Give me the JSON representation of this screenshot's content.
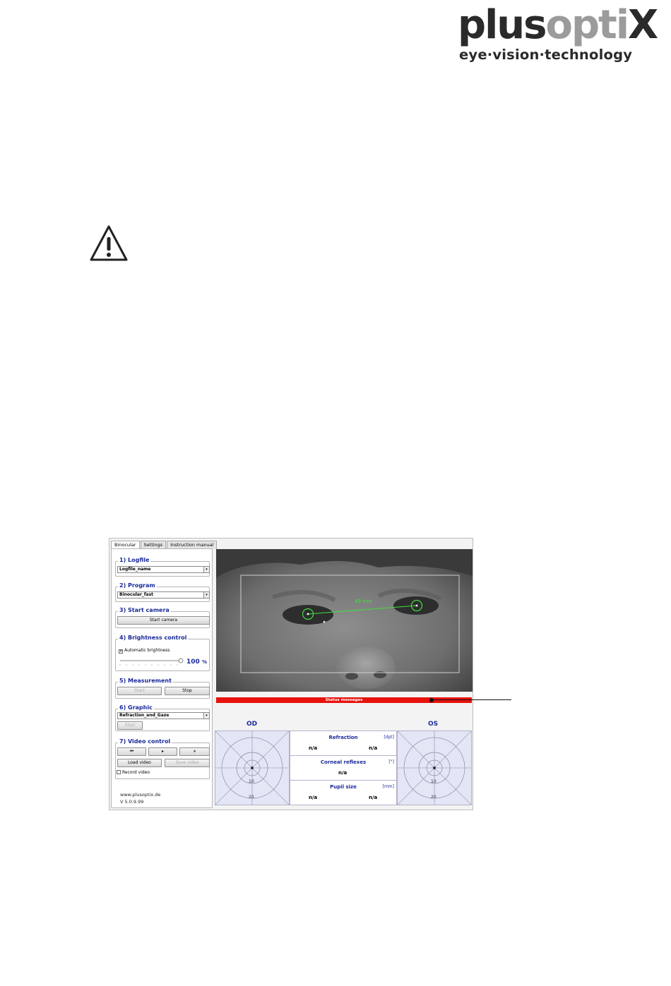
{
  "logo": {
    "word_plus": "plus",
    "word_optix": "opti",
    "word_x": "X",
    "tagline": "eye·vision·technology"
  },
  "warning": {
    "icon": "warning-triangle-icon"
  },
  "app": {
    "tabs": [
      "Binocular",
      "Settings",
      "Instruction manual"
    ],
    "logfile": {
      "title": "1) Logfile",
      "value": "Logfile_name"
    },
    "program": {
      "title": "2) Program",
      "value": "Binocular_fast"
    },
    "start_camera": {
      "title": "3) Start camera",
      "button": "Start camera"
    },
    "brightness": {
      "title": "4) Brightness control",
      "auto_label": "Automatic brightness",
      "auto_checked": true,
      "value": 1.0,
      "readout": "100",
      "unit": "%"
    },
    "measurement": {
      "title": "5) Measurement",
      "start": "Start",
      "stop": "Stop"
    },
    "graphic": {
      "title": "6) Graphic",
      "value": "Refraction_and_Gaze",
      "start": "Start"
    },
    "video": {
      "title": "7) Video control",
      "rewind": "⏮",
      "play": "▸",
      "pause": "⏸",
      "load": "Load video",
      "save": "Save video",
      "record": "Record video"
    },
    "footer": {
      "url": "www.plusoptix.de",
      "version": "V 5.0.9.99"
    },
    "camera": {
      "pd_label": "49 mm"
    },
    "status": {
      "text": "Status messages",
      "color": "#e8120c"
    },
    "od": {
      "label": "OD",
      "rings": [
        "10",
        "20"
      ]
    },
    "os": {
      "label": "OS",
      "rings": [
        "10",
        "20"
      ]
    },
    "results": {
      "refraction": {
        "title": "Refraction",
        "unit": "[dpt]",
        "left": "n/a",
        "right": "n/a"
      },
      "corneal": {
        "title": "Corneal reflexes",
        "unit": "[°]",
        "value": "n/a"
      },
      "pupil": {
        "title": "Pupil size",
        "unit": "[mm]",
        "left": "n/a",
        "right": "n/a"
      }
    }
  }
}
